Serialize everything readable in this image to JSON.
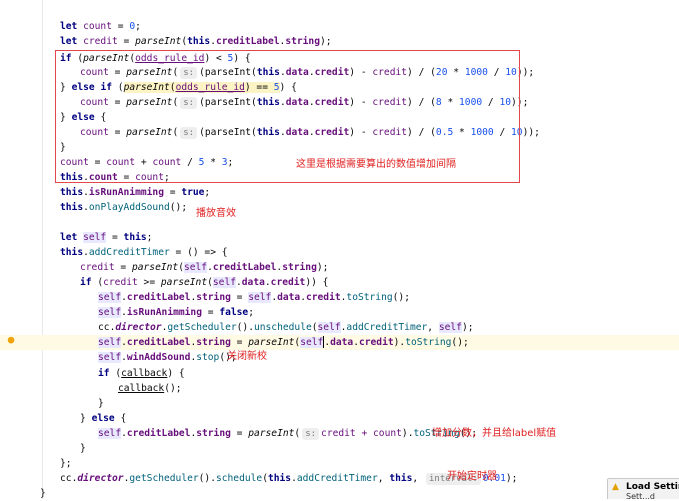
{
  "annotations": {
    "interval": "这里是根据需要算出的数值增加间隔",
    "play_sound": "播放音效",
    "close_new": "关闭新校",
    "add_score": "增加分数，并且给label赋值",
    "start_timer": "开始定时器"
  },
  "hints": {
    "s": "s:",
    "interval": "interval:"
  },
  "notification": {
    "title": "Load Settings",
    "subtitle": "Sett...d"
  },
  "code": {
    "l1": {
      "a": "let ",
      "b": "count",
      "c": " = ",
      "d": "0",
      "e": ";"
    },
    "l2": {
      "a": "let ",
      "b": "credit",
      "c": " = ",
      "d": "parseInt",
      "e": "(",
      "f": "this",
      "g": ".",
      "h": "creditLabel",
      "i": ".",
      "j": "string",
      "k": ");"
    },
    "l3": {
      "a": "if",
      "b": " (",
      "c": "parseInt",
      "d": "(",
      "e": "odds_rule_id",
      "f": ")",
      "g": " < ",
      "h": "5",
      "i": ") {"
    },
    "l4": {
      "a": "count",
      "b": " = ",
      "c": "parseInt",
      "d": "(",
      "f": "(parseInt(",
      "g": "this",
      "h": ".",
      "i": "data",
      "j": ".",
      "k": "credit",
      "l": ") - ",
      "m": "credit",
      "n": ") / (",
      "o": "20",
      "p": " * ",
      "q": "1000",
      "r": " / ",
      "s": "10",
      "t": "));"
    },
    "l5": {
      "a": "} ",
      "b": "else if",
      "c": " (",
      "d": "parseInt",
      "e": "(",
      "f": "odds_rule_id",
      "g": ")",
      "h": " == ",
      "i": "5",
      "j": ") {"
    },
    "l6": {
      "a": "count",
      "b": " = ",
      "c": "parseInt",
      "d": "(",
      "f": "(parseInt(",
      "g": "this",
      "h": ".",
      "i": "data",
      "j": ".",
      "k": "credit",
      "l": ") - ",
      "m": "credit",
      "n": ") / (",
      "o": "8",
      "p": " * ",
      "q": "1000",
      "r": " / ",
      "s": "10",
      "t": "));"
    },
    "l7": {
      "a": "} ",
      "b": "else",
      "c": " {"
    },
    "l8": {
      "a": "count",
      "b": " = ",
      "c": "parseInt",
      "d": "(",
      "f": "(parseInt(",
      "g": "this",
      "h": ".",
      "i": "data",
      "j": ".",
      "k": "credit",
      "l": ") - ",
      "m": "credit",
      "n": ") / (",
      "o": "0.5",
      "p": " * ",
      "q": "1000",
      "r": " / ",
      "s": "10",
      "t": "));"
    },
    "l9": {
      "a": "}"
    },
    "l10": {
      "a": "count",
      "b": " = ",
      "c": "count",
      "d": " + ",
      "e": "count",
      "f": " / ",
      "g": "5",
      "h": " * ",
      "i": "3",
      "j": ";"
    },
    "l11": {
      "a": "this",
      "b": ".",
      "c": "count",
      "d": " = ",
      "e": "count",
      "f": ";"
    },
    "l12": {
      "a": "this",
      "b": ".",
      "c": "isRunAnimming",
      "d": " = ",
      "e": "true",
      "f": ";"
    },
    "l13": {
      "a": "this",
      "b": ".",
      "c": "onPlayAddSound",
      "d": "();"
    },
    "l14": {
      "a": "let ",
      "b": "self",
      "c": " = ",
      "d": "this",
      "e": ";"
    },
    "l15": {
      "a": "this",
      "b": ".",
      "c": "addCreditTimer",
      "d": " = () => {"
    },
    "l16": {
      "a": "credit",
      "b": " = ",
      "c": "parseInt",
      "d": "(",
      "e": "self",
      "f": ".",
      "g": "creditLabel",
      "h": ".",
      "i": "string",
      "j": ");"
    },
    "l17": {
      "a": "if",
      "b": " (",
      "c": "credit",
      "d": " >= ",
      "e": "parseInt",
      "f": "(",
      "g": "self",
      "h": ".",
      "i": "data",
      "j": ".",
      "k": "credit",
      "l": ")) {"
    },
    "l18": {
      "a": "self",
      "b": ".",
      "c": "creditLabel",
      "d": ".",
      "e": "string",
      "f": " = ",
      "g": "self",
      "h": ".",
      "i": "data",
      "j": ".",
      "k": "credit",
      "l": ".",
      "m": "toString",
      "n": "();"
    },
    "l19": {
      "a": "self",
      "b": ".",
      "c": "isRunAnimming",
      "d": " = ",
      "e": "false",
      "f": ";"
    },
    "l20": {
      "a": "cc",
      "b": ".",
      "c": "director",
      "d": ".",
      "e": "getScheduler",
      "f": "().",
      "g": "unschedule",
      "h": "(",
      "i": "self",
      "j": ".",
      "k": "addCreditTimer",
      "l": ", ",
      "m": "self",
      "n": ");"
    },
    "l21": {
      "a": "self",
      "b": ".",
      "c": "creditLabel",
      "d": ".",
      "e": "string",
      "f": " = ",
      "g": "parseInt",
      "h": "(",
      "i": "self",
      "j": ".",
      "k": "data",
      "l": ".",
      "m": "credit",
      "n": ").",
      "o": "toString",
      "p": "();"
    },
    "l22": {
      "a": "self",
      "b": ".",
      "c": "winAddSound",
      "d": ".",
      "e": "stop",
      "f": "();"
    },
    "l23": {
      "a": "if",
      "b": " (",
      "c": "callback",
      "d": ") {"
    },
    "l24": {
      "a": "callback",
      "b": "();"
    },
    "l25": {
      "a": "}"
    },
    "l26": {
      "a": "} ",
      "b": "else",
      "c": " {"
    },
    "l27": {
      "a": "self",
      "b": ".",
      "c": "creditLabel",
      "d": ".",
      "e": "string",
      "f": " = ",
      "g": "parseInt",
      "h": "(",
      "j": "credit + ",
      "k": "count",
      "l": ").",
      "m": "toString",
      "n": "();"
    },
    "l28": {
      "a": "}"
    },
    "l29": {
      "a": "};"
    },
    "l30": {
      "a": "cc",
      "b": ".",
      "c": "director",
      "d": ".",
      "e": "getScheduler",
      "f": "().",
      "g": "schedule",
      "h": "(",
      "i": "this",
      "j": ".",
      "k": "addCreditTimer",
      "l": ", ",
      "m": "this",
      "n": ", ",
      "p": "0.01",
      "q": ");"
    },
    "l31": {
      "a": "}"
    }
  },
  "colors": {
    "highlight_box": "#e3464c",
    "annotation_text": "#e02020",
    "current_line": "#fffae3"
  }
}
